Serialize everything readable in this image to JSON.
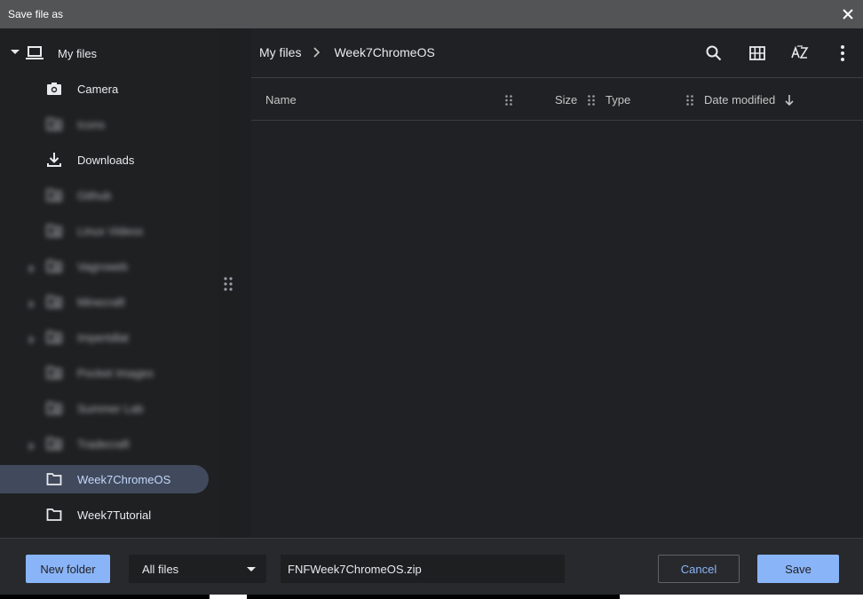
{
  "window": {
    "title": "Save file as"
  },
  "sidebar": {
    "root": {
      "label": "My files",
      "icon": "laptop-icon"
    },
    "items": [
      {
        "label": "Camera",
        "icon": "camera-icon",
        "blurred": false,
        "expandable": false,
        "selected": false
      },
      {
        "label": "Icons",
        "icon": "folder-shared-icon",
        "blurred": true,
        "expandable": false,
        "selected": false
      },
      {
        "label": "Downloads",
        "icon": "download-icon",
        "blurred": false,
        "expandable": false,
        "selected": false
      },
      {
        "label": "Github",
        "icon": "folder-shared-icon",
        "blurred": true,
        "expandable": false,
        "selected": false
      },
      {
        "label": "Linux Videos",
        "icon": "folder-shared-icon",
        "blurred": true,
        "expandable": false,
        "selected": false
      },
      {
        "label": "Vagrvweb",
        "icon": "folder-shared-icon",
        "blurred": true,
        "expandable": true,
        "selected": false
      },
      {
        "label": "Minecraft",
        "icon": "folder-shared-icon",
        "blurred": true,
        "expandable": true,
        "selected": false
      },
      {
        "label": "Impertdlat",
        "icon": "folder-shared-icon",
        "blurred": true,
        "expandable": true,
        "selected": false
      },
      {
        "label": "Pocket Images",
        "icon": "folder-shared-icon",
        "blurred": true,
        "expandable": false,
        "selected": false
      },
      {
        "label": "Summer Lab",
        "icon": "folder-shared-icon",
        "blurred": true,
        "expandable": false,
        "selected": false
      },
      {
        "label": "Tradecraft",
        "icon": "folder-shared-icon",
        "blurred": true,
        "expandable": true,
        "selected": false
      },
      {
        "label": "Week7ChromeOS",
        "icon": "folder-icon",
        "blurred": false,
        "expandable": false,
        "selected": true
      },
      {
        "label": "Week7Tutorial",
        "icon": "folder-icon",
        "blurred": false,
        "expandable": false,
        "selected": false
      }
    ]
  },
  "breadcrumb": {
    "parent": "My files",
    "current": "Week7ChromeOS"
  },
  "toolbar": {
    "icons": [
      "search-icon",
      "grid-view-icon",
      "sort-az-icon",
      "more-vert-icon"
    ]
  },
  "columns": {
    "name": "Name",
    "size": "Size",
    "type": "Type",
    "date_modified": "Date modified"
  },
  "footer": {
    "new_folder_label": "New folder",
    "file_type_value": "All files",
    "filename_value": "FNFWeek7ChromeOS.zip",
    "cancel_label": "Cancel",
    "save_label": "Save"
  },
  "colors": {
    "accent": "#8ab4f8",
    "selected_bg": "#414a5c",
    "titlebar": "#535456",
    "background": "#202124"
  }
}
